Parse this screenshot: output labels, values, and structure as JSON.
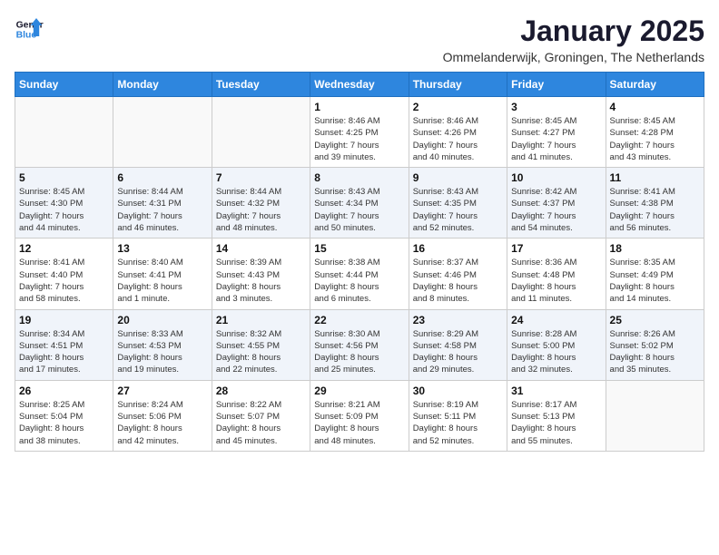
{
  "logo": {
    "line1": "General",
    "line2": "Blue"
  },
  "title": "January 2025",
  "subtitle": "Ommelanderwijk, Groningen, The Netherlands",
  "weekdays": [
    "Sunday",
    "Monday",
    "Tuesday",
    "Wednesday",
    "Thursday",
    "Friday",
    "Saturday"
  ],
  "weeks": [
    [
      {
        "day": "",
        "info": ""
      },
      {
        "day": "",
        "info": ""
      },
      {
        "day": "",
        "info": ""
      },
      {
        "day": "1",
        "info": "Sunrise: 8:46 AM\nSunset: 4:25 PM\nDaylight: 7 hours\nand 39 minutes."
      },
      {
        "day": "2",
        "info": "Sunrise: 8:46 AM\nSunset: 4:26 PM\nDaylight: 7 hours\nand 40 minutes."
      },
      {
        "day": "3",
        "info": "Sunrise: 8:45 AM\nSunset: 4:27 PM\nDaylight: 7 hours\nand 41 minutes."
      },
      {
        "day": "4",
        "info": "Sunrise: 8:45 AM\nSunset: 4:28 PM\nDaylight: 7 hours\nand 43 minutes."
      }
    ],
    [
      {
        "day": "5",
        "info": "Sunrise: 8:45 AM\nSunset: 4:30 PM\nDaylight: 7 hours\nand 44 minutes."
      },
      {
        "day": "6",
        "info": "Sunrise: 8:44 AM\nSunset: 4:31 PM\nDaylight: 7 hours\nand 46 minutes."
      },
      {
        "day": "7",
        "info": "Sunrise: 8:44 AM\nSunset: 4:32 PM\nDaylight: 7 hours\nand 48 minutes."
      },
      {
        "day": "8",
        "info": "Sunrise: 8:43 AM\nSunset: 4:34 PM\nDaylight: 7 hours\nand 50 minutes."
      },
      {
        "day": "9",
        "info": "Sunrise: 8:43 AM\nSunset: 4:35 PM\nDaylight: 7 hours\nand 52 minutes."
      },
      {
        "day": "10",
        "info": "Sunrise: 8:42 AM\nSunset: 4:37 PM\nDaylight: 7 hours\nand 54 minutes."
      },
      {
        "day": "11",
        "info": "Sunrise: 8:41 AM\nSunset: 4:38 PM\nDaylight: 7 hours\nand 56 minutes."
      }
    ],
    [
      {
        "day": "12",
        "info": "Sunrise: 8:41 AM\nSunset: 4:40 PM\nDaylight: 7 hours\nand 58 minutes."
      },
      {
        "day": "13",
        "info": "Sunrise: 8:40 AM\nSunset: 4:41 PM\nDaylight: 8 hours\nand 1 minute."
      },
      {
        "day": "14",
        "info": "Sunrise: 8:39 AM\nSunset: 4:43 PM\nDaylight: 8 hours\nand 3 minutes."
      },
      {
        "day": "15",
        "info": "Sunrise: 8:38 AM\nSunset: 4:44 PM\nDaylight: 8 hours\nand 6 minutes."
      },
      {
        "day": "16",
        "info": "Sunrise: 8:37 AM\nSunset: 4:46 PM\nDaylight: 8 hours\nand 8 minutes."
      },
      {
        "day": "17",
        "info": "Sunrise: 8:36 AM\nSunset: 4:48 PM\nDaylight: 8 hours\nand 11 minutes."
      },
      {
        "day": "18",
        "info": "Sunrise: 8:35 AM\nSunset: 4:49 PM\nDaylight: 8 hours\nand 14 minutes."
      }
    ],
    [
      {
        "day": "19",
        "info": "Sunrise: 8:34 AM\nSunset: 4:51 PM\nDaylight: 8 hours\nand 17 minutes."
      },
      {
        "day": "20",
        "info": "Sunrise: 8:33 AM\nSunset: 4:53 PM\nDaylight: 8 hours\nand 19 minutes."
      },
      {
        "day": "21",
        "info": "Sunrise: 8:32 AM\nSunset: 4:55 PM\nDaylight: 8 hours\nand 22 minutes."
      },
      {
        "day": "22",
        "info": "Sunrise: 8:30 AM\nSunset: 4:56 PM\nDaylight: 8 hours\nand 25 minutes."
      },
      {
        "day": "23",
        "info": "Sunrise: 8:29 AM\nSunset: 4:58 PM\nDaylight: 8 hours\nand 29 minutes."
      },
      {
        "day": "24",
        "info": "Sunrise: 8:28 AM\nSunset: 5:00 PM\nDaylight: 8 hours\nand 32 minutes."
      },
      {
        "day": "25",
        "info": "Sunrise: 8:26 AM\nSunset: 5:02 PM\nDaylight: 8 hours\nand 35 minutes."
      }
    ],
    [
      {
        "day": "26",
        "info": "Sunrise: 8:25 AM\nSunset: 5:04 PM\nDaylight: 8 hours\nand 38 minutes."
      },
      {
        "day": "27",
        "info": "Sunrise: 8:24 AM\nSunset: 5:06 PM\nDaylight: 8 hours\nand 42 minutes."
      },
      {
        "day": "28",
        "info": "Sunrise: 8:22 AM\nSunset: 5:07 PM\nDaylight: 8 hours\nand 45 minutes."
      },
      {
        "day": "29",
        "info": "Sunrise: 8:21 AM\nSunset: 5:09 PM\nDaylight: 8 hours\nand 48 minutes."
      },
      {
        "day": "30",
        "info": "Sunrise: 8:19 AM\nSunset: 5:11 PM\nDaylight: 8 hours\nand 52 minutes."
      },
      {
        "day": "31",
        "info": "Sunrise: 8:17 AM\nSunset: 5:13 PM\nDaylight: 8 hours\nand 55 minutes."
      },
      {
        "day": "",
        "info": ""
      }
    ]
  ]
}
